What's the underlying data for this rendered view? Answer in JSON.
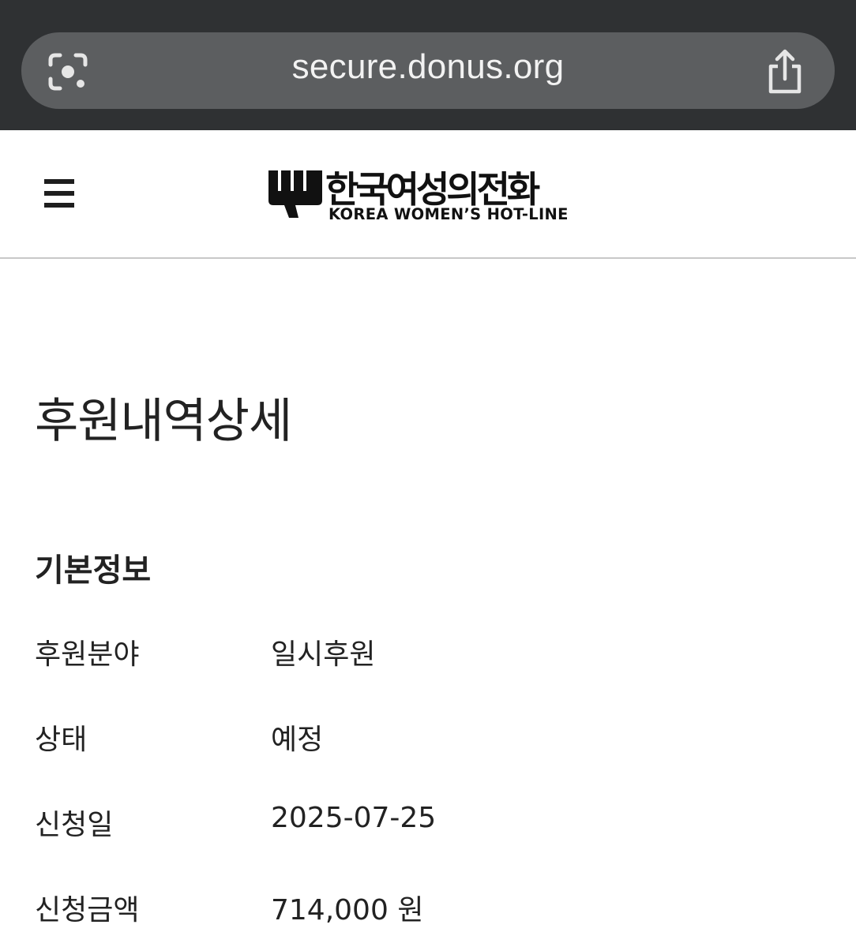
{
  "browser": {
    "url": "secure.donus.org",
    "lens_icon": "google-lens-icon",
    "share_icon": "share-icon"
  },
  "header": {
    "menu_icon": "hamburger-menu-icon",
    "logo": {
      "korean_name": "한국여성의전화",
      "english_name": "KOREA WOMEN’S HOT-LINE"
    }
  },
  "main": {
    "title": "후원내역상세",
    "section_title": "기본정보",
    "rows": [
      {
        "label": "후원분야",
        "value": "일시후원"
      },
      {
        "label": "상태",
        "value": "예정"
      },
      {
        "label": "신청일",
        "value": "2025-07-25"
      },
      {
        "label": "신청금액",
        "value": "714,000 원"
      }
    ]
  }
}
